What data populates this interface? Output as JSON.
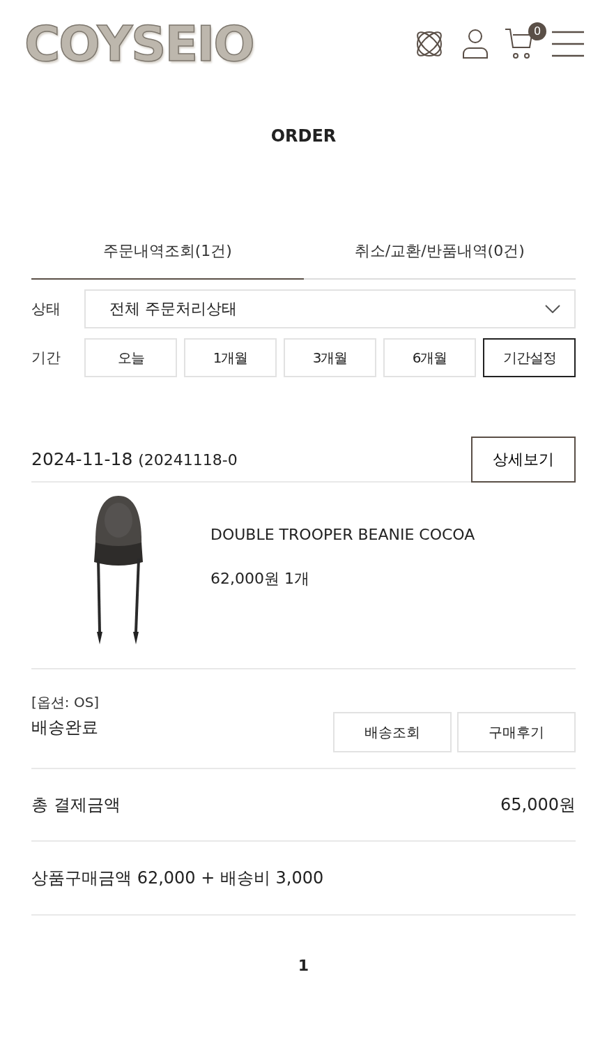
{
  "header": {
    "logo": "COYSEIO",
    "cart_count": "0"
  },
  "title": "ORDER",
  "tabs": [
    {
      "label": "주문내역조회(1건)",
      "selected": true
    },
    {
      "label": "취소/교환/반품내역(0건)",
      "selected": false
    }
  ],
  "filter": {
    "status_label": "상태",
    "status_value": "전체 주문처리상태",
    "period_label": "기간",
    "periods": [
      {
        "label": "오늘",
        "selected": false
      },
      {
        "label": "1개월",
        "selected": false
      },
      {
        "label": "3개월",
        "selected": false
      },
      {
        "label": "6개월",
        "selected": false
      },
      {
        "label": "기간설정",
        "selected": true
      }
    ]
  },
  "order": {
    "date": "2024-11-18",
    "number": "(20241118-0",
    "detail_button": "상세보기",
    "product": {
      "kind": "picture",
      "name": "DOUBLE TROOPER BEANIE COCOA",
      "price": "62,000원 1개"
    },
    "option": "[옵션: OS]",
    "status": "배송완료",
    "actions": [
      "배송조회",
      "구매후기"
    ],
    "total_label": "총 결제금액",
    "total": "65,000원",
    "breakdown": "상품구매금액 62,000 + 배송비 3,000"
  },
  "pagination": [
    {
      "label": "1",
      "selected": true
    }
  ]
}
